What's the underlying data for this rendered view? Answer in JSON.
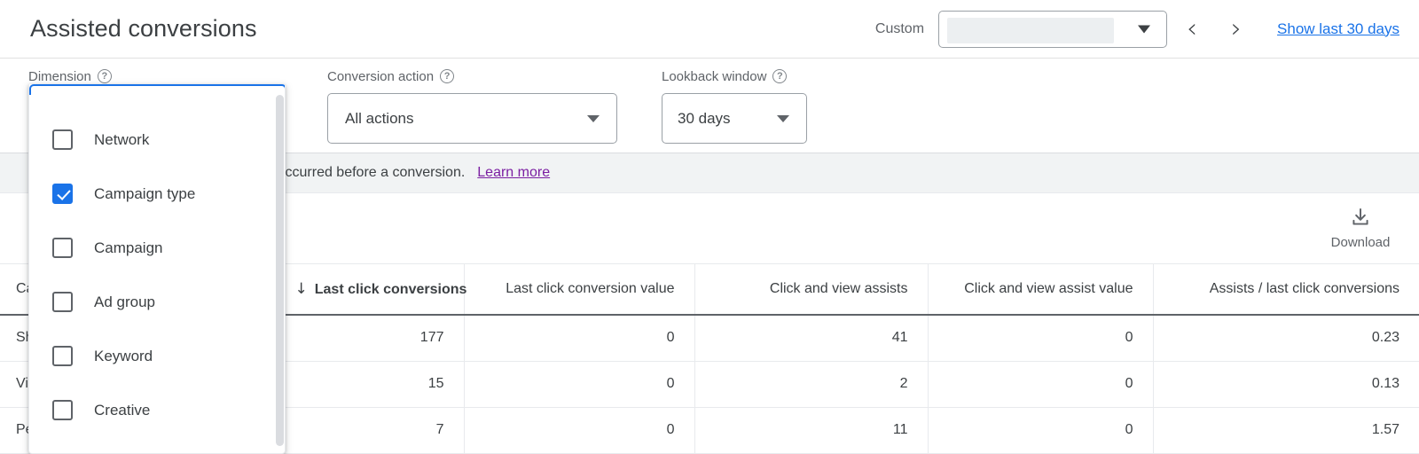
{
  "header": {
    "title": "Assisted conversions",
    "custom_label": "Custom",
    "date_value": "",
    "prev_icon": "chevron-left-icon",
    "next_icon": "chevron-right-icon",
    "show_last_link": "Show last 30 days"
  },
  "filters": [
    {
      "label": "Dimension",
      "value": "",
      "help": "?"
    },
    {
      "label": "Conversion action",
      "value": "All actions",
      "help": "?"
    },
    {
      "label": "Lookback window",
      "value": "30 days",
      "help": "?"
    }
  ],
  "banner": {
    "text": "ons, excluding the last interaction, that occurred before a conversion.",
    "link": "Learn more"
  },
  "toolbar": {
    "download_label": "Download",
    "download_icon": "download-icon"
  },
  "dimension_dropdown": {
    "open": true,
    "items": [
      {
        "label": "Network",
        "checked": false
      },
      {
        "label": "Campaign type",
        "checked": true
      },
      {
        "label": "Campaign",
        "checked": false
      },
      {
        "label": "Ad group",
        "checked": false
      },
      {
        "label": "Keyword",
        "checked": false
      },
      {
        "label": "Creative",
        "checked": false
      }
    ]
  },
  "table": {
    "sorted_column_index": 1,
    "sort_arrow": "↓",
    "columns": [
      "Ca",
      "Last click conversions",
      "Last click conversion value",
      "Click and view assists",
      "Click and view assist value",
      "Assists / last click conversions"
    ],
    "rows": [
      {
        "cells": [
          "Sho",
          "177",
          "0",
          "41",
          "0",
          "0.23"
        ]
      },
      {
        "cells": [
          "Vid",
          "15",
          "0",
          "2",
          "0",
          "0.13"
        ]
      },
      {
        "cells": [
          "Pe",
          "7",
          "0",
          "11",
          "0",
          "1.57"
        ]
      }
    ]
  },
  "colors": {
    "accent_blue": "#1a73e8",
    "link_purple": "#7b1fa2",
    "text_primary": "#3c4043",
    "text_secondary": "#5f6368",
    "banner_bg": "#f1f3f4"
  }
}
